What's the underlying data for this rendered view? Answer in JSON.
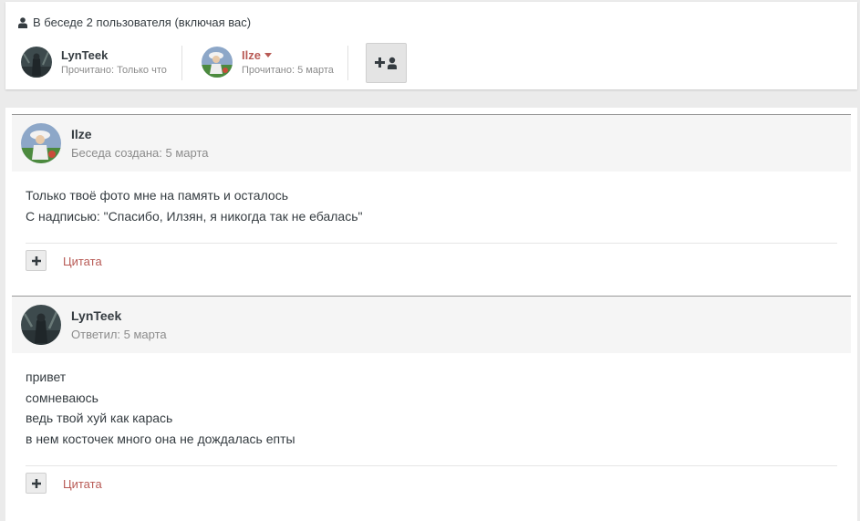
{
  "participants": {
    "title": "В беседе 2 пользователя (включая вас)",
    "title_icon": "user-icon",
    "users": [
      {
        "name": "LynTeek",
        "read": "Прочитано: Только что"
      },
      {
        "name": "Ilze",
        "read": "Прочитано: 5 марта"
      }
    ],
    "add_button_icon": "add-user-icon"
  },
  "messages": [
    {
      "author": "Ilze",
      "meta": "Беседа создана: 5 марта",
      "lines": [
        "Только твоё фото мне на память и осталось",
        "С надписью: \"Спасибо, Илзян, я никогда так не ебалась\""
      ],
      "quote_label": "Цитата"
    },
    {
      "author": "LynTeek",
      "meta": "Ответил: 5 марта",
      "lines": [
        "привет",
        "сомневаюсь",
        "ведь твой хуй как карась",
        "в нем косточек много она не дождалась епты"
      ],
      "quote_label": "Цитата"
    }
  ],
  "colors": {
    "accent": "#b85a55",
    "text": "#353c41",
    "muted": "#8c8c8c",
    "background": "#ebebeb",
    "header_bg": "#f5f5f5"
  }
}
